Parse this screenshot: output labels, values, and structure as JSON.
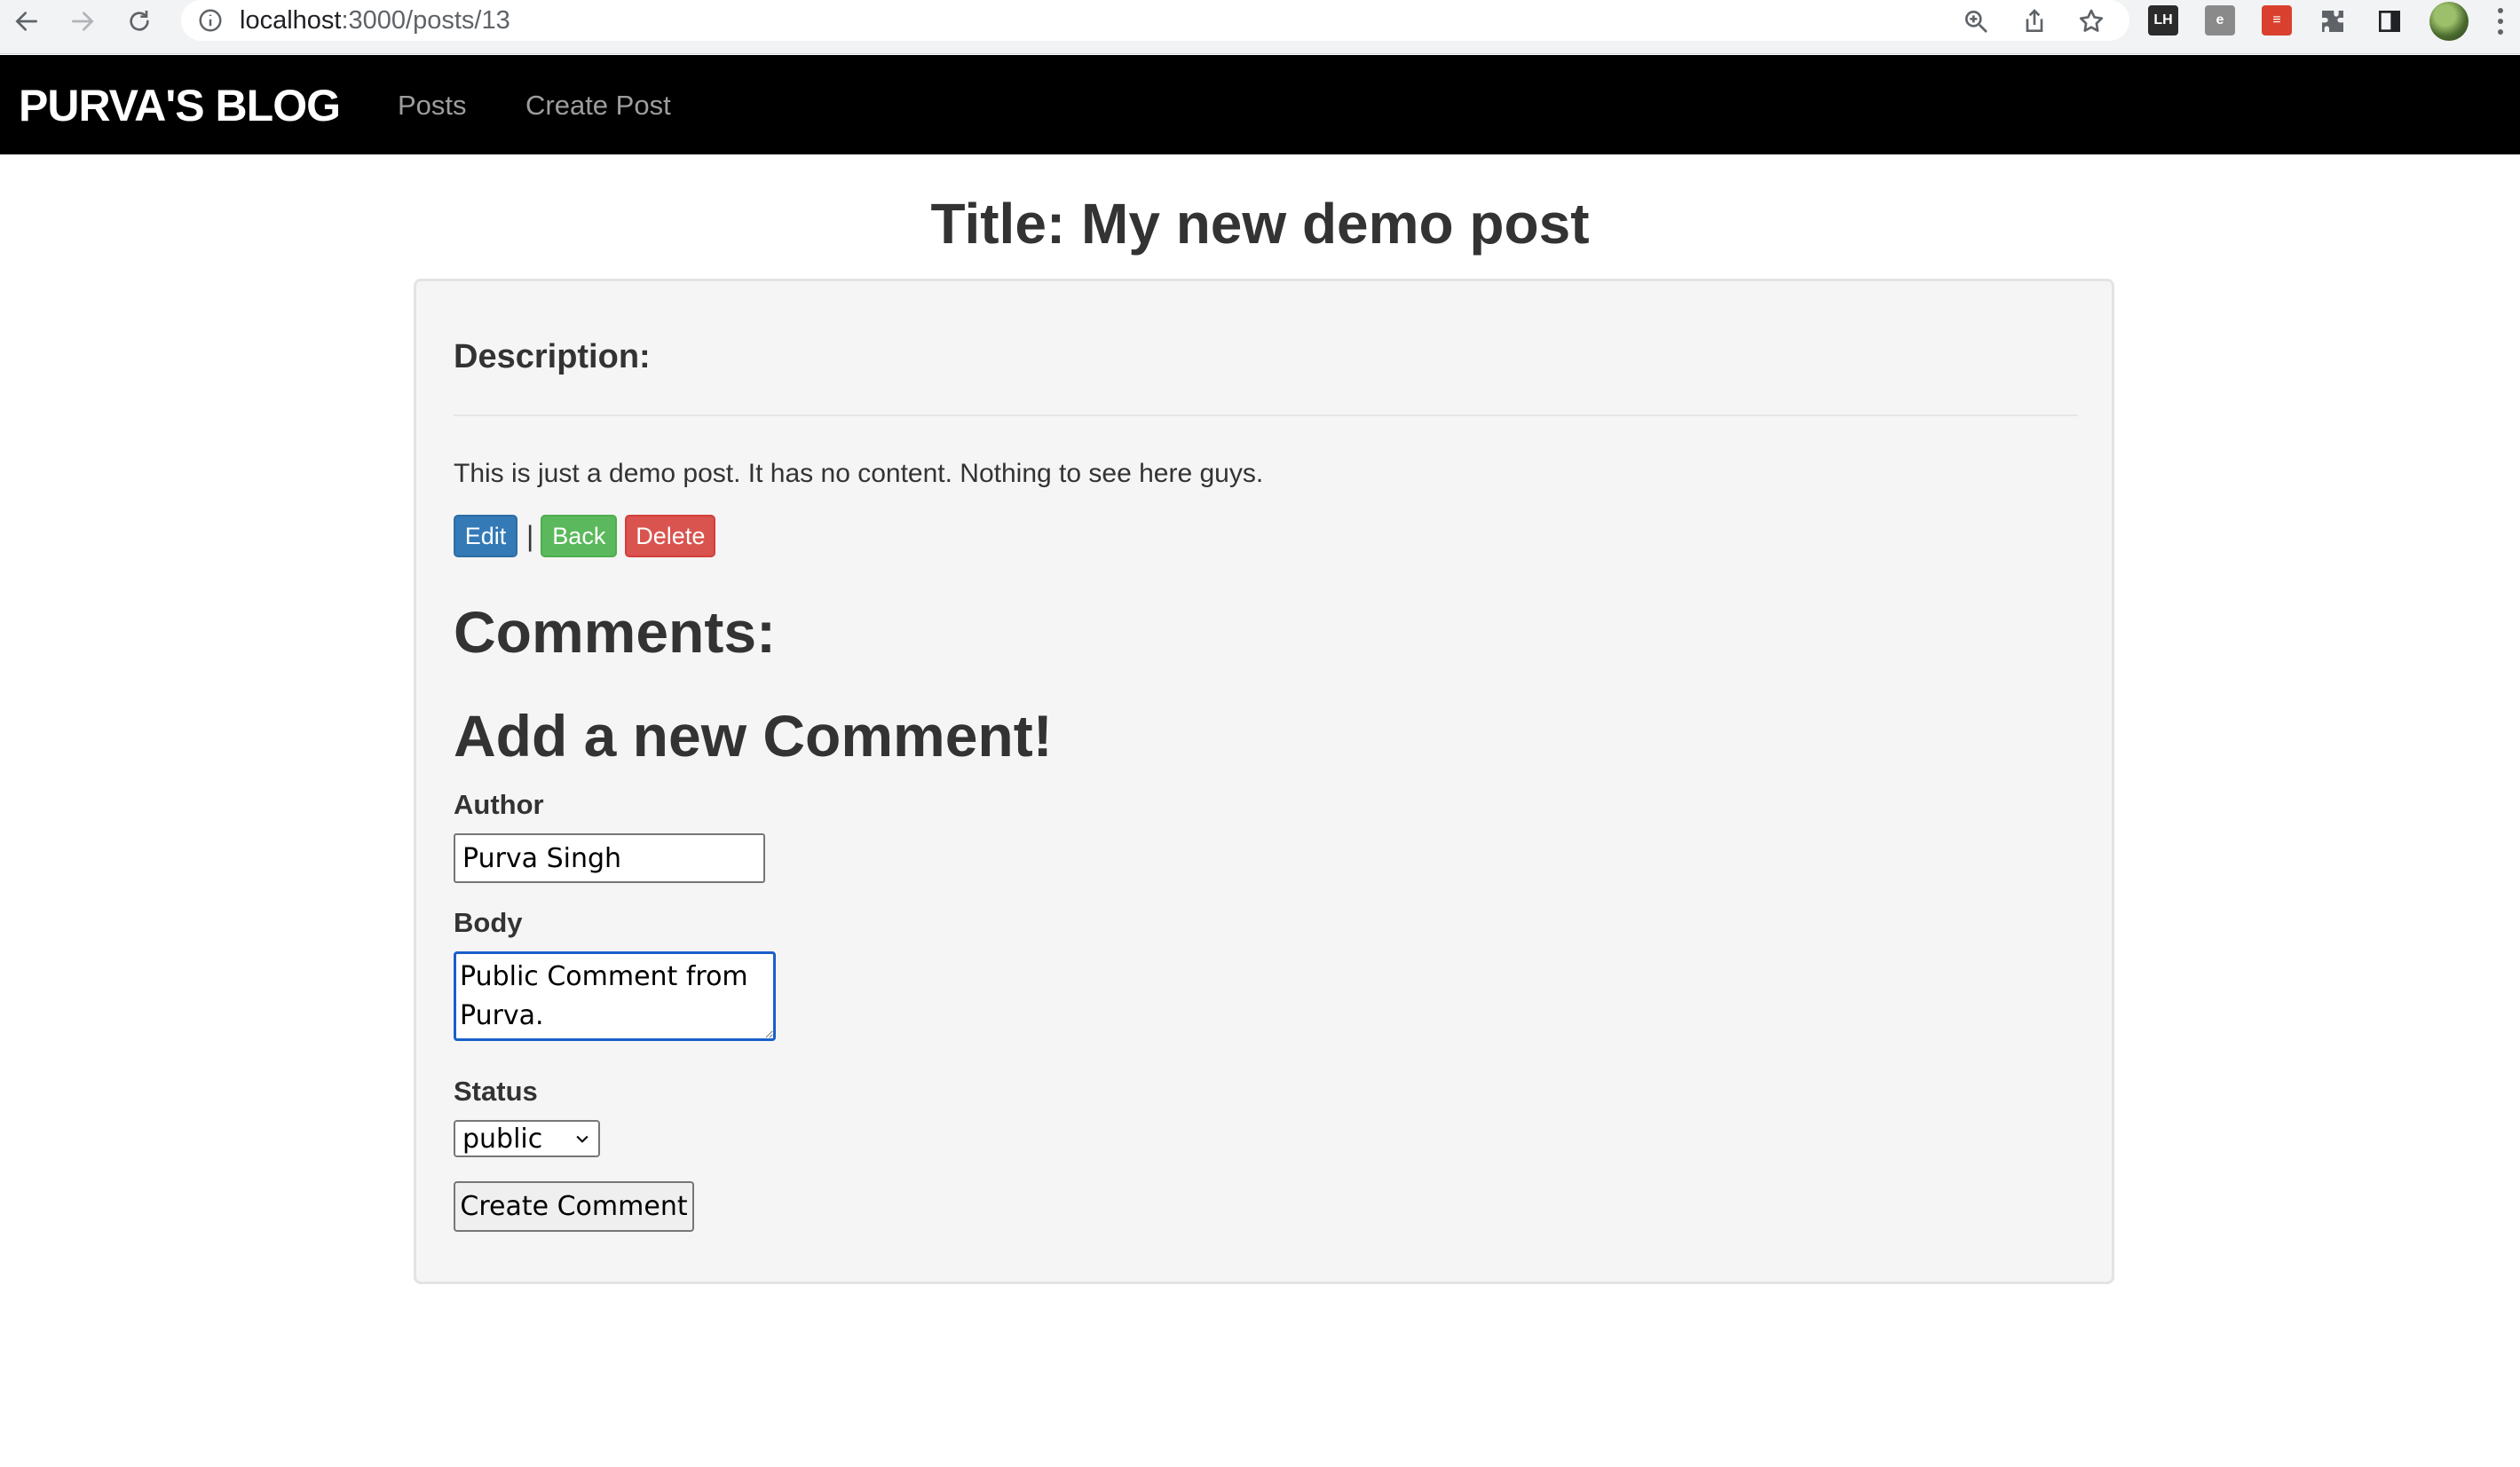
{
  "browser": {
    "url_host": "localhost",
    "url_path": ":3000/posts/13"
  },
  "navbar": {
    "brand": "PURVA'S BLOG",
    "links": [
      "Posts",
      "Create Post"
    ]
  },
  "post": {
    "title": "Title: My new demo post",
    "description_heading": "Description:",
    "description_text": "This is just a demo post. It has no content. Nothing to see here guys.",
    "actions": {
      "edit_label": "Edit",
      "separator": "|",
      "back_label": "Back",
      "delete_label": "Delete"
    },
    "action_colors": {
      "edit": "#337ab7",
      "back": "#5cb85c",
      "delete": "#d9534f"
    }
  },
  "comments": {
    "heading": "Comments:",
    "new_heading": "Add a new Comment!",
    "form": {
      "author_label": "Author",
      "author_value": "Purva Singh",
      "body_label": "Body",
      "body_value": "Public Comment from Purva.",
      "status_label": "Status",
      "status_value": "public",
      "submit_label": "Create Comment"
    }
  },
  "colors": {
    "navbar_bg": "#000000",
    "nav_link": "#9d9d9d",
    "panel_bg": "#f5f5f5"
  }
}
